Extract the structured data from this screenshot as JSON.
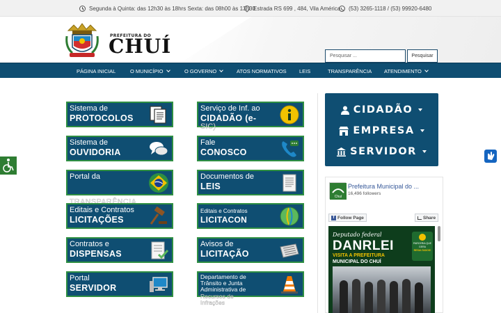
{
  "topbar": {
    "hours": "Segunda à Quinta: das 12h30 às 18hrs Sexta: das 08h00 às 13h30",
    "address": "Estrada RS 699 , 484, Vila América",
    "phones": "(53) 3265-1118 / (53) 99920-6480"
  },
  "logo": {
    "small": "PREFEITURA DO",
    "big": "CHUÍ"
  },
  "search": {
    "placeholder": "Pesquisar ...",
    "button": "Pesquisar"
  },
  "nav": [
    {
      "label": "PÁGINA INICIAL"
    },
    {
      "label": "O MUNICÍPIO"
    },
    {
      "label": "O GOVERNO"
    },
    {
      "label": "ATOS NORMATIVOS"
    },
    {
      "label": "LEIS"
    },
    {
      "label": "TRANSPARÊNCIA"
    },
    {
      "label": "ATENDIMENTO"
    }
  ],
  "tiles": [
    {
      "line1": "Sistema de",
      "line2": "PROTOCOLOS",
      "icon": "documents-icon"
    },
    {
      "line1": "Serviço de Inf. ao",
      "line2": "CIDADÃO (e-",
      "overflow": "SIC)",
      "icon": "info-icon"
    },
    {
      "line1": "Sistema de",
      "line2": "OUVIDORIA",
      "icon": "speech-bubbles-icon"
    },
    {
      "line1": "Fale",
      "line2": "CONOSCO",
      "icon": "phone-icon"
    },
    {
      "line1": "Portal da",
      "overflow": "TRANSPARÊNCIA",
      "icon": "brazil-flag-icon"
    },
    {
      "line1": "Documentos de",
      "line2": "LEIS",
      "icon": "document-icon"
    },
    {
      "line1": "Editais e Contratos",
      "line2": "LICITAÇÕES",
      "icon": "gavel-icon"
    },
    {
      "line1": "Editais e Contratos",
      "line2": "LICITACON",
      "icon": "globe-icon"
    },
    {
      "line1": "Contratos e",
      "line2": "DISPENSAS",
      "icon": "checklist-icon"
    },
    {
      "line1": "Avisos de",
      "line2": "LICITAÇÃO",
      "icon": "newspaper-icon"
    },
    {
      "line1": "Portal",
      "line2": "SERVIDOR",
      "icon": "computer-icon"
    },
    {
      "line1": "Departamento de",
      "line1b": "Trânsito e Junta",
      "line1c": "Administrativa de",
      "overflow": "Recursos de",
      "overflow2": "Infrações",
      "icon": "traffic-cone-icon"
    }
  ],
  "sidebar": {
    "items": [
      {
        "label": "CIDADÃO",
        "icon": "person-icon"
      },
      {
        "label": "EMPRESA",
        "icon": "store-icon"
      },
      {
        "label": "SERVIDOR",
        "icon": "building-icon"
      }
    ]
  },
  "facebook": {
    "page_name": "Prefeitura Municipal do ...",
    "followers": "16,496 followers",
    "follow_label": "Follow Page",
    "share_label": "Share",
    "avatar_text": "Chuí",
    "post": {
      "line1": "Deputado federal",
      "line2": "DANRLEI",
      "line3": "VISITA A PREFEITURA",
      "line4": "MUNICIPAL DO CHUÍ",
      "badge1": "PARCERIA QUE",
      "badge2": "GERA",
      "badge3": "RESULTADOS!"
    }
  },
  "colors": {
    "primary": "#0f4e72",
    "tile_border": "#2e8f42",
    "accessibility": "#2e7d32",
    "libras": "#1565c0"
  }
}
